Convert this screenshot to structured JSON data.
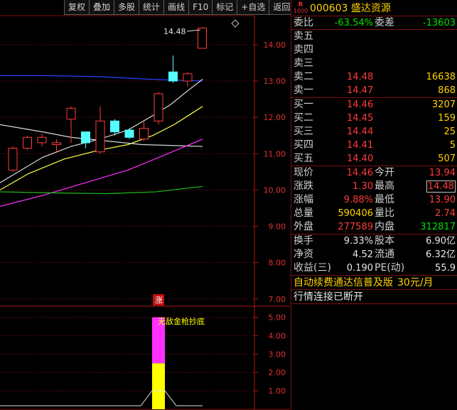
{
  "toolbar": [
    "复权",
    "叠加",
    "多股",
    "统计",
    "画线",
    "F10",
    "标记",
    "+自选",
    "返回"
  ],
  "price_axis": [
    "14.00",
    "13.00",
    "12.00",
    "11.00",
    "10.00",
    "9.00",
    "8.00",
    "7.00"
  ],
  "indicator_axis": [
    "5.00",
    "4.00",
    "3.00",
    "2.00",
    "1.00"
  ],
  "high_marker": "14.48",
  "zhang_badge": "涨",
  "indicator_text": "无敌金枪抄底",
  "chart_data": {
    "type": "candlestick",
    "price_range": [
      6.8,
      14.8
    ],
    "candles": [
      {
        "open": 10.55,
        "close": 11.15,
        "high": 11.2,
        "low": 10.5
      },
      {
        "open": 11.15,
        "close": 11.45,
        "high": 11.5,
        "low": 11.1
      },
      {
        "open": 11.3,
        "close": 11.45,
        "high": 11.55,
        "low": 11.2
      },
      {
        "open": 11.25,
        "close": 11.3,
        "high": 11.4,
        "low": 11.05
      },
      {
        "open": 11.95,
        "close": 12.25,
        "high": 12.3,
        "low": 11.3
      },
      {
        "open": 11.6,
        "close": 11.3,
        "high": 11.6,
        "low": 11.15
      },
      {
        "open": 11.05,
        "close": 11.9,
        "high": 12.3,
        "low": 11.0
      },
      {
        "open": 11.9,
        "close": 11.6,
        "high": 11.95,
        "low": 11.5
      },
      {
        "open": 11.65,
        "close": 11.45,
        "high": 11.7,
        "low": 11.4
      },
      {
        "open": 11.4,
        "close": 11.7,
        "high": 11.9,
        "low": 11.35
      },
      {
        "open": 11.9,
        "close": 12.65,
        "high": 12.7,
        "low": 11.8
      },
      {
        "open": 13.25,
        "close": 13.0,
        "high": 13.7,
        "low": 12.95
      },
      {
        "open": 13.0,
        "close": 13.2,
        "high": 13.25,
        "low": 12.85
      },
      {
        "open": 13.9,
        "close": 14.46,
        "high": 14.48,
        "low": 13.9
      }
    ],
    "indicator": {
      "range": [
        0,
        5.6
      ],
      "yellow": [
        0,
        2.5
      ],
      "magenta": [
        2.5,
        5.0
      ]
    }
  },
  "quote": {
    "code": "000603",
    "name": "盛达资源",
    "badge_r": "R",
    "badge_sub": "1000",
    "weibi_label": "委比",
    "weibi": "-63.54%",
    "weicha_label": "委差",
    "weicha": "-13603",
    "sell": [
      {
        "label": "卖五",
        "price": "",
        "vol": ""
      },
      {
        "label": "卖四",
        "price": "",
        "vol": ""
      },
      {
        "label": "卖三",
        "price": "",
        "vol": ""
      },
      {
        "label": "卖二",
        "price": "14.48",
        "vol": "16638"
      },
      {
        "label": "卖一",
        "price": "14.47",
        "vol": "868"
      }
    ],
    "buy": [
      {
        "label": "买一",
        "price": "14.46",
        "vol": "3207"
      },
      {
        "label": "买二",
        "price": "14.45",
        "vol": "159"
      },
      {
        "label": "买三",
        "price": "14.44",
        "vol": "25"
      },
      {
        "label": "买四",
        "price": "14.41",
        "vol": "5"
      },
      {
        "label": "买五",
        "price": "14.40",
        "vol": "507"
      }
    ],
    "stats": [
      {
        "l1": "现价",
        "v1": "14.46",
        "c1": "red",
        "l2": "今开",
        "v2": "13.94",
        "c2": "red"
      },
      {
        "l1": "涨跌",
        "v1": "1.30",
        "c1": "red",
        "l2": "最高",
        "v2": "14.48",
        "c2": "red",
        "box2": true
      },
      {
        "l1": "涨幅",
        "v1": "9.88%",
        "c1": "red",
        "l2": "最低",
        "v2": "13.90",
        "c2": "red"
      },
      {
        "l1": "总量",
        "v1": "590406",
        "c1": "yellow",
        "l2": "量比",
        "v2": "2.74",
        "c2": "red"
      },
      {
        "l1": "外盘",
        "v1": "277589",
        "c1": "red",
        "l2": "内盘",
        "v2": "312817",
        "c2": "green"
      }
    ],
    "fin": [
      {
        "l1": "换手",
        "v1": "9.33%",
        "l2": "股本",
        "v2": "6.90亿"
      },
      {
        "l1": "净资",
        "v1": "4.52",
        "l2": "流通",
        "v2": "6.32亿"
      },
      {
        "l1": "收益(三)",
        "v1": "0.190",
        "l2": "PE(动)",
        "v2": "55.9"
      }
    ],
    "ad_text": "自动续费通达信普及版",
    "ad_price": "30元/月",
    "status": "行情连接已断开"
  },
  "colors": {
    "up": "#ff3b3b",
    "down": "#54ffff",
    "ma_white": "#d8d8d8",
    "ma_yellow": "#ffff40",
    "ma_magenta": "#ff30ff",
    "ma_green": "#20c020",
    "ma_blue": "#2a40ff"
  }
}
